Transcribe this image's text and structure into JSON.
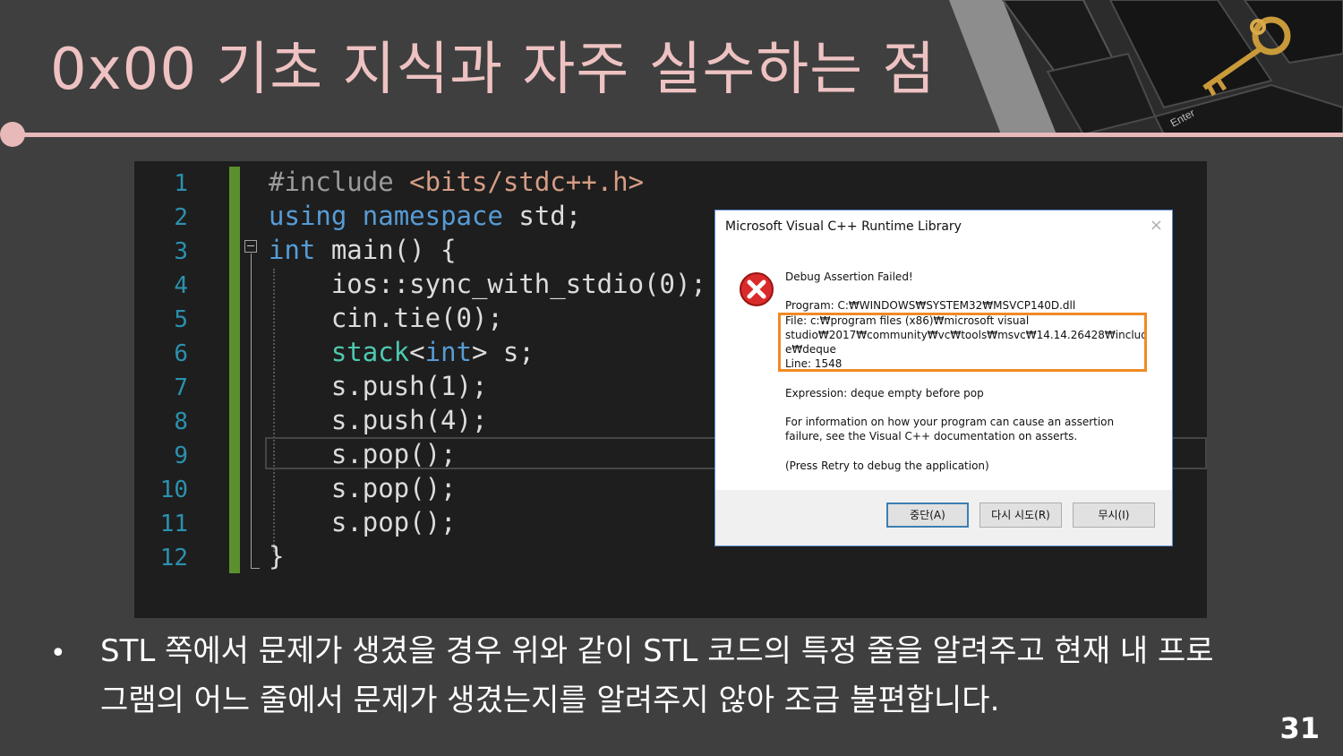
{
  "slide": {
    "title": "0x00  기초 지식과 자주 실수하는 점",
    "page_number": "31"
  },
  "keyboard_image": {
    "key_label": "Enter",
    "icon": "key-icon"
  },
  "code": {
    "line_numbers": [
      "1",
      "2",
      "3",
      "4",
      "5",
      "6",
      "7",
      "8",
      "9",
      "10",
      "11",
      "12"
    ],
    "lines": [
      "#include <bits/stdc++.h>",
      "using namespace std;",
      "int main() {",
      "    ios::sync_with_stdio(0);",
      "    cin.tie(0);",
      "    stack<int> s;",
      "    s.push(1);",
      "    s.push(4);",
      "    s.pop();",
      "    s.pop();",
      "    s.pop();",
      "}"
    ]
  },
  "dialog": {
    "title": "Microsoft Visual C++ Runtime Library",
    "close_symbol": "×",
    "icon": "error-icon",
    "heading": "Debug Assertion Failed!",
    "program": "Program: C:₩WINDOWS₩SYSTEM32₩MSVCP140D.dll",
    "file": "File: c:₩program files (x86)₩microsoft visual\nstudio₩2017₩community₩vc₩tools₩msvc₩14.14.26428₩includ\ne₩deque",
    "line": "Line: 1548",
    "expression": "Expression: deque empty before pop",
    "info": "For information on how your program can cause an assertion\nfailure, see the Visual C++ documentation on asserts.",
    "press": "(Press Retry to debug the application)",
    "buttons": [
      "중단(A)",
      "다시 시도(R)",
      "무시(I)"
    ]
  },
  "bullet": {
    "symbol": "•",
    "text": "STL 쪽에서 문제가 생겼을 경우 위와 같이 STL 코드의 특정 줄을 알려주고 현재 내 프로그램의 어느 줄에서 문제가 생겼는지를 알려주지 않아 조금 불편합니다."
  },
  "colors": {
    "background": "#3f3f3f",
    "accent": "#e8b9b9",
    "highlight": "#f08a24"
  }
}
